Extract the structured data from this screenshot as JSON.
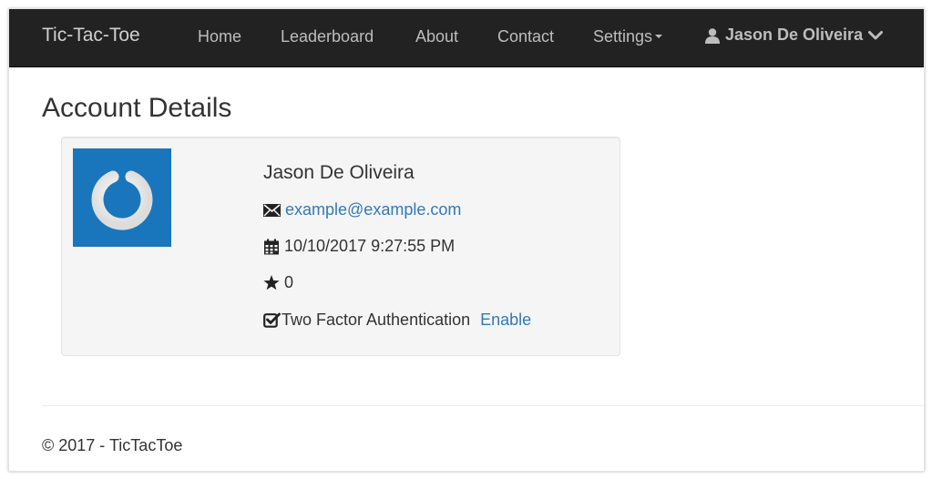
{
  "navbar": {
    "brand": "Tic-Tac-Toe",
    "items": [
      {
        "label": "Home"
      },
      {
        "label": "Leaderboard"
      },
      {
        "label": "About"
      },
      {
        "label": "Contact"
      },
      {
        "label": "Settings"
      }
    ],
    "user_menu_label": "Jason De Oliveira",
    "user_icon": "user-icon",
    "dropdown_icon": "chevron-down-icon"
  },
  "page": {
    "title": "Account Details"
  },
  "account": {
    "avatar_icon": "power-logo-icon",
    "name": "Jason De Oliveira",
    "email": "example@example.com",
    "email_icon": "envelope-icon",
    "created": "10/10/2017 9:27:55 PM",
    "created_icon": "calendar-icon",
    "score": "0",
    "score_icon": "star-icon",
    "two_factor_label": "Two Factor Authentication",
    "two_factor_icon": "check-square-icon",
    "two_factor_action": "Enable"
  },
  "footer": {
    "text": "© 2017 - TicTacToe"
  },
  "colors": {
    "navbar_bg": "#222222",
    "link": "#337ab7",
    "avatar_bg": "#1a76bc"
  }
}
